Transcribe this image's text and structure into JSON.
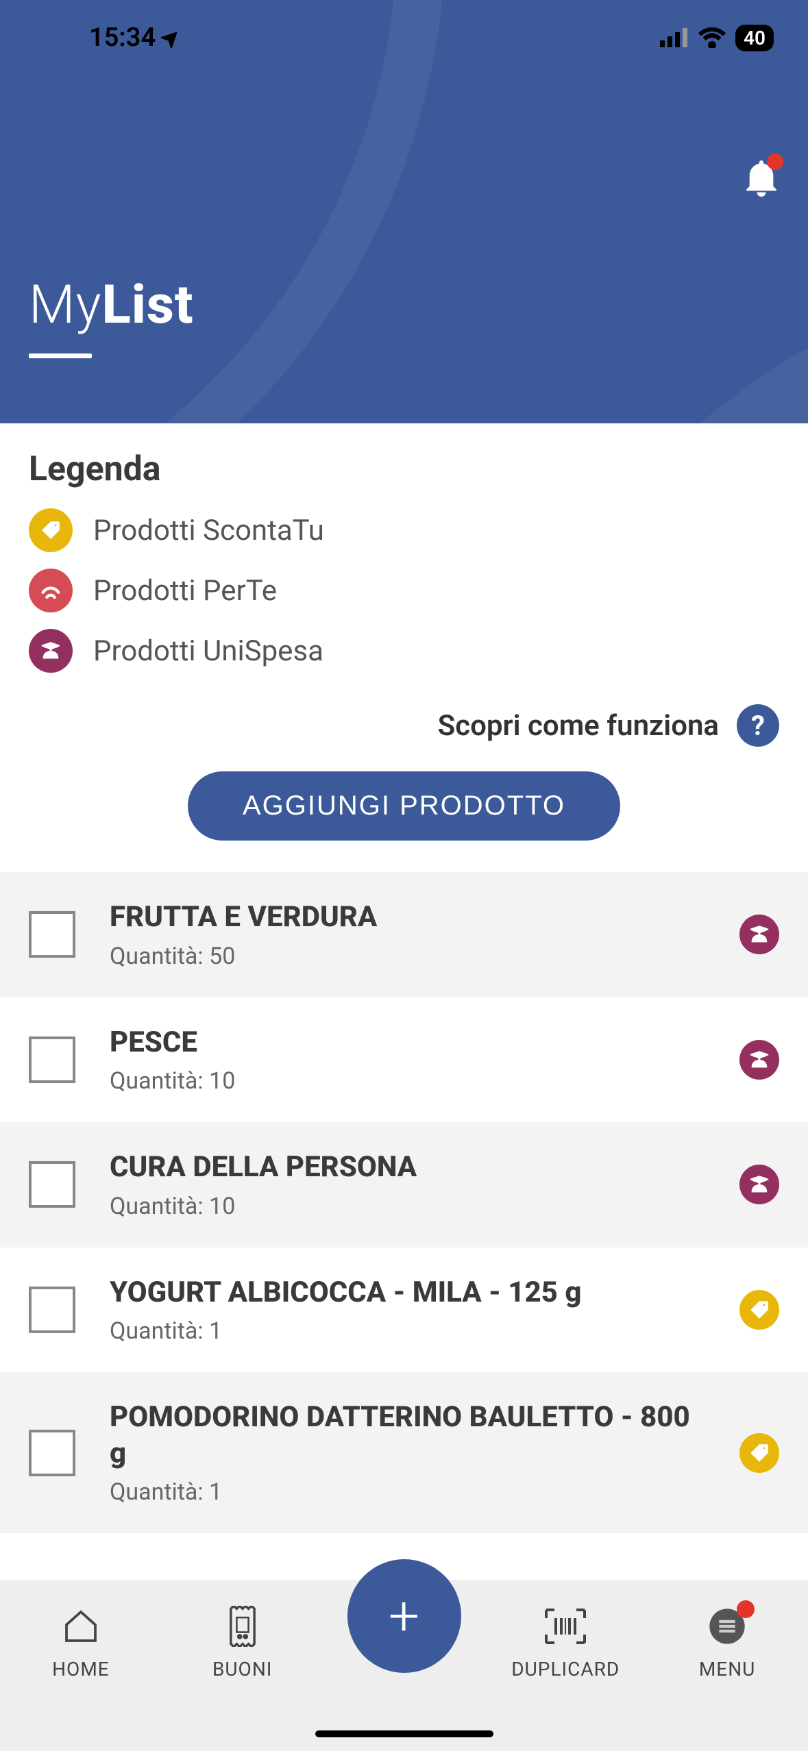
{
  "status": {
    "time": "15:34",
    "battery": "40"
  },
  "header": {
    "title_light": "My",
    "title_bold": "List"
  },
  "legend": {
    "title": "Legenda",
    "items": [
      {
        "label": "Prodotti ScontaTu",
        "badge": "yellow"
      },
      {
        "label": "Prodotti PerTe",
        "badge": "red"
      },
      {
        "label": "Prodotti UniSpesa",
        "badge": "maroon"
      }
    ]
  },
  "discover": {
    "text": "Scopri come funziona",
    "help": "?"
  },
  "add_button": "AGGIUNGI PRODOTTO",
  "qty_prefix": "Quantità: ",
  "items": [
    {
      "name": "FRUTTA E VERDURA",
      "qty": "50",
      "badge": "maroon",
      "alt": true
    },
    {
      "name": "PESCE",
      "qty": "10",
      "badge": "maroon",
      "alt": false
    },
    {
      "name": "CURA DELLA PERSONA",
      "qty": "10",
      "badge": "maroon",
      "alt": true
    },
    {
      "name": "YOGURT ALBICOCCA - MILA - 125 g",
      "qty": "1",
      "badge": "yellow",
      "alt": false
    },
    {
      "name": "POMODORINO DATTERINO BAULETTO - 800 g",
      "qty": "1",
      "badge": "yellow",
      "alt": true
    }
  ],
  "nav": {
    "home": "HOME",
    "buoni": "BUONI",
    "plus": "+",
    "duplicard": "DUPLICARD",
    "menu": "MENU"
  },
  "colors": {
    "primary": "#3c5a99",
    "yellow": "#e7b70b",
    "maroon": "#93305f",
    "red": "#d64c56",
    "alert": "#e4352b"
  }
}
